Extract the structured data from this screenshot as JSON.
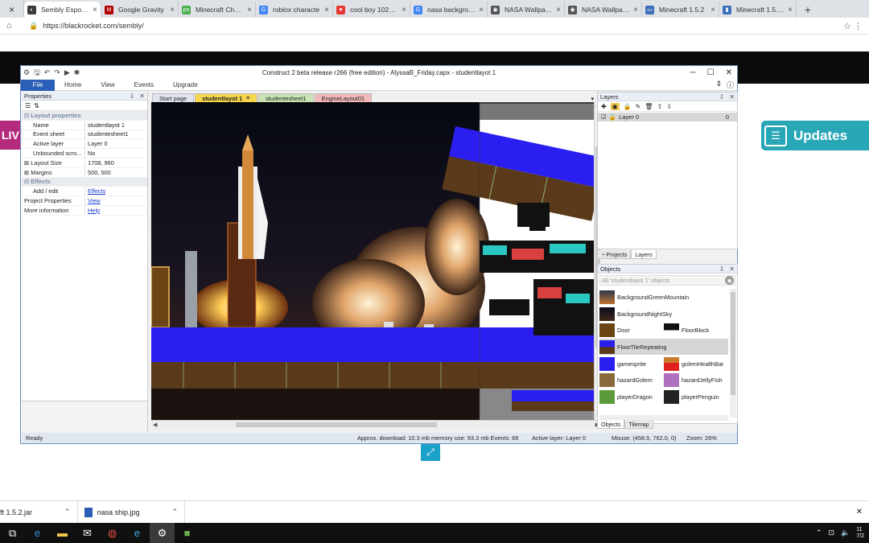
{
  "browser": {
    "tabs": [
      {
        "label": "Sembly Esports |",
        "color": "#3a3a3a",
        "glyph": "◐",
        "active": true
      },
      {
        "label": "Google Gravity",
        "color": "#b00000",
        "glyph": "M"
      },
      {
        "label": "Minecraft Chara",
        "color": "#4caf50",
        "glyph": "px"
      },
      {
        "label": "roblox characte",
        "color": "#4285f4",
        "glyph": "G"
      },
      {
        "label": "cool boy 1024*5",
        "color": "#e53935",
        "glyph": "♥"
      },
      {
        "label": "nasa backgroun",
        "color": "#4285f4",
        "glyph": "G"
      },
      {
        "label": "NASA Wallpaper",
        "color": "#555555",
        "glyph": "◉"
      },
      {
        "label": "NASA Wallpaper",
        "color": "#555555",
        "glyph": "◉"
      },
      {
        "label": "Minecraft 1.5.2",
        "color": "#3d6fb8",
        "glyph": "▭"
      },
      {
        "label": "Minecraft 1.5.2.ja",
        "color": "#3d6fb8",
        "glyph": "▮"
      }
    ],
    "url": "https://blackrocket.com/sembly/"
  },
  "page": {
    "live_badge": "LIV",
    "updates_label": "Updates"
  },
  "construct": {
    "window_title": "Construct 2 beta release r266  (free edition) - AlyssaB_Friday.capx - studentlayot 1",
    "ribbon": {
      "file": "File",
      "home": "Home",
      "view": "View",
      "events": "Events",
      "upgrade": "Upgrade"
    },
    "properties": {
      "title": "Properties",
      "layout_properties": "Layout properties",
      "rows": [
        {
          "key": "Name",
          "value": "studentlayot 1"
        },
        {
          "key": "Event sheet",
          "value": "studentesheet1"
        },
        {
          "key": "Active layer",
          "value": "Layer 0"
        },
        {
          "key": "Unbounded scro...",
          "value": "No"
        },
        {
          "key": "Layout Size",
          "value": "1708, 960",
          "expand": true
        },
        {
          "key": "Margins",
          "value": "500, 500",
          "expand": true
        }
      ],
      "effects": "Effects",
      "add_edit": "Add / edit",
      "effects_link": "Effects",
      "project_properties": "Project Properties",
      "view_link": "View",
      "more_information": "More information",
      "help_link": "Help"
    },
    "doc_tabs": [
      {
        "label": "Start page"
      },
      {
        "label": "studentlayot 1"
      },
      {
        "label": "studentesheet1"
      },
      {
        "label": "EngineLayout01"
      }
    ],
    "layers": {
      "title": "Layers",
      "items": [
        {
          "name": "Layer 0",
          "index": "0"
        }
      ],
      "tabs": [
        "Projects",
        "Layers"
      ]
    },
    "objects": {
      "title": "Objects",
      "filter": "All 'studentlayot 1' objects",
      "items": [
        "BackgroundGreenMountain",
        "BackgroundNightSky",
        "Door",
        "FloorBlock",
        "FloorTileRepeating",
        "gamesprite",
        "golemHealthBar",
        "hazardGolem",
        "hazardJellyFish",
        "playerDragon",
        "playerPenguin"
      ],
      "tabs": [
        "Objects",
        "Tilemap"
      ]
    },
    "status": {
      "ready": "Ready",
      "download": "Approx. download: 10.3 mb  memory use: 93.3 mb  Events: 66",
      "active_layer": "Active layer: Layer 0",
      "mouse": "Mouse: (458.5, 762.0, 0)",
      "zoom": "Zoom: 26%"
    }
  },
  "downloads": [
    {
      "name": "ft 1.5.2.jar"
    },
    {
      "name": "nasa ship.jpg"
    }
  ],
  "taskbar": {
    "time": "11",
    "date": "7/2"
  },
  "colors": {
    "floor_blue": "#2a1ff0",
    "accent_file": "#2b5fb7",
    "updates": "#2aa7b7",
    "live": "#b42a7d"
  }
}
